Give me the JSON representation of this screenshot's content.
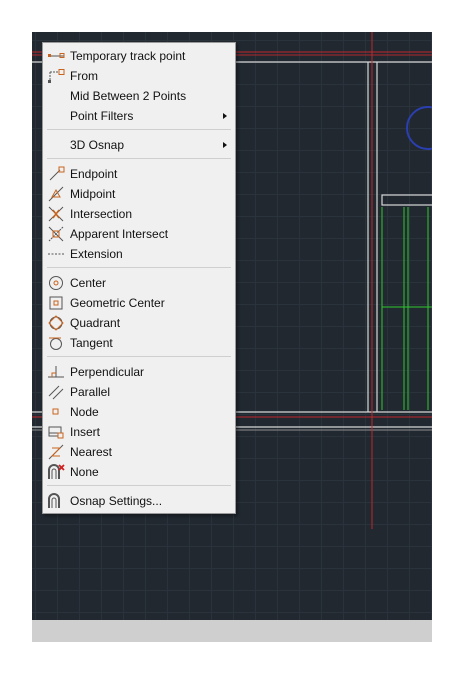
{
  "menu": {
    "items": [
      {
        "label": "Temporary track point",
        "icon": "temporary-track-point-icon"
      },
      {
        "label": "From",
        "icon": "from-icon"
      },
      {
        "label": "Mid Between 2 Points",
        "icon": ""
      },
      {
        "label": "Point Filters",
        "icon": "",
        "submenu": true
      },
      {
        "label": "3D Osnap",
        "icon": "",
        "submenu": true
      },
      {
        "label": "Endpoint",
        "icon": "endpoint-icon"
      },
      {
        "label": "Midpoint",
        "icon": "midpoint-icon"
      },
      {
        "label": "Intersection",
        "icon": "intersection-icon"
      },
      {
        "label": "Apparent Intersect",
        "icon": "apparent-intersect-icon"
      },
      {
        "label": "Extension",
        "icon": "extension-icon"
      },
      {
        "label": "Center",
        "icon": "center-icon"
      },
      {
        "label": "Geometric Center",
        "icon": "geometric-center-icon"
      },
      {
        "label": "Quadrant",
        "icon": "quadrant-icon"
      },
      {
        "label": "Tangent",
        "icon": "tangent-icon"
      },
      {
        "label": "Perpendicular",
        "icon": "perpendicular-icon"
      },
      {
        "label": "Parallel",
        "icon": "parallel-icon"
      },
      {
        "label": "Node",
        "icon": "node-icon"
      },
      {
        "label": "Insert",
        "icon": "insert-icon"
      },
      {
        "label": "Nearest",
        "icon": "nearest-icon"
      },
      {
        "label": "None",
        "icon": "none-icon"
      },
      {
        "label": "Osnap Settings...",
        "icon": "osnap-settings-icon"
      }
    ]
  },
  "colors": {
    "canvas_bg": "#212830",
    "menu_bg": "#f0f0f0",
    "icon_orange": "#c8641e",
    "drawing_red": "#c0282d",
    "drawing_green": "#2ec82e",
    "drawing_white": "#d8d8d8",
    "circle_blue": "#2a3fb0"
  }
}
